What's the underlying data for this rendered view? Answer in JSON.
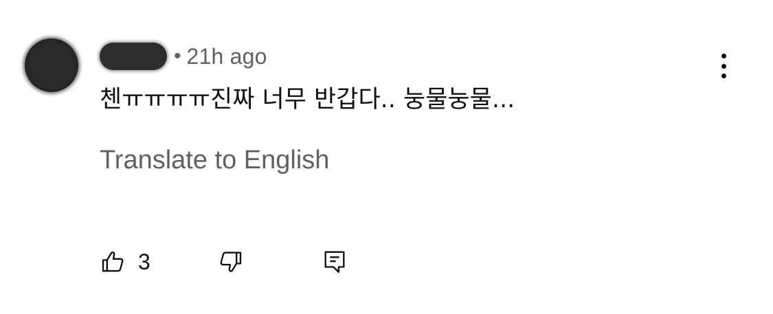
{
  "comment": {
    "time": "21h ago",
    "separator": "•",
    "text": "첸ㅠㅠㅠㅠ진짜 너무 반갑다.. 눙물눙물...",
    "translate_label": "Translate to English"
  },
  "actions": {
    "like_count": "3"
  },
  "icons": {
    "like": "thumbs-up-icon",
    "dislike": "thumbs-down-icon",
    "reply": "comment-reply-icon",
    "menu": "more-vertical-icon"
  },
  "colors": {
    "primary_text": "#0f0f0f",
    "secondary_text": "#606060",
    "background": "#ffffff"
  }
}
